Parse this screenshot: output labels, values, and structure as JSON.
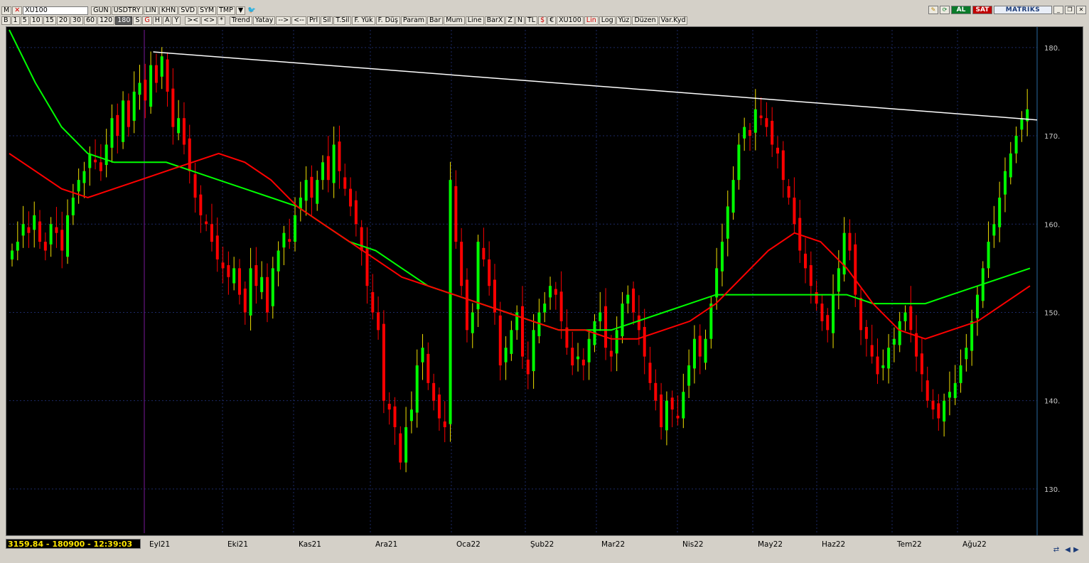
{
  "toolbar_top": {
    "menu_m": "M",
    "symbol": "XU100",
    "buttons": [
      "GUN",
      "USDTRY",
      "LIN",
      "KHN",
      "SVD",
      "SYM",
      "TMP"
    ],
    "al": "AL",
    "sat": "SAT",
    "brand": "MATRIKS"
  },
  "toolbar_periods": [
    "B",
    "1",
    "5",
    "10",
    "15",
    "20",
    "30",
    "60",
    "120",
    "180",
    "S",
    "G",
    "H",
    "A",
    "Y"
  ],
  "toolbar_nav": [
    "><",
    "<>",
    "*"
  ],
  "toolbar_tools": [
    "Trend",
    "Yatay",
    "-->",
    "<--",
    "Prl",
    "Sil",
    "T.Sil",
    "F. Yük",
    "F. Düş",
    "Param",
    "Bar",
    "Mum",
    "Line",
    "BarX",
    "Z",
    "N",
    "TL",
    "$",
    "€",
    "XU100",
    "Lin",
    "Log",
    "Yüz",
    "Düzen",
    "Var.Kyd"
  ],
  "status_text": "3159.84 - 180900 - 12:39:03",
  "colors": {
    "background": "#000000",
    "grid": "#1c2a66",
    "up": "#00ff00",
    "down": "#ff0000",
    "wick_up": "#f0e000",
    "ma_short": "#ff0000",
    "ma_long": "#00ff00",
    "trendline": "#ffffff"
  },
  "chart_data": {
    "type": "candlestick",
    "y_ticks": [
      "130.",
      "140.",
      "150.",
      "160.",
      "170.",
      "180."
    ],
    "ylim": [
      125,
      182
    ],
    "x_labels": [
      "Eyl21",
      "Eki21",
      "Kas21",
      "Ara21",
      "Oca22",
      "Şub22",
      "Mar22",
      "Nis22",
      "May22",
      "Haz22",
      "Tem22",
      "Ağu22"
    ],
    "candle_closes": [
      157,
      158,
      160,
      159,
      161,
      158,
      157,
      160,
      159,
      157,
      161,
      163,
      165,
      166,
      168,
      167,
      166,
      169,
      172,
      170,
      174,
      171,
      175,
      176,
      174,
      178,
      176,
      179,
      175,
      171,
      172,
      169,
      166,
      163,
      161,
      160,
      158,
      156,
      155,
      154,
      155,
      152,
      150,
      155,
      153,
      154,
      150,
      155,
      157,
      159,
      158,
      161,
      163,
      165,
      163,
      165,
      167,
      165,
      169,
      166,
      164,
      162,
      160,
      157,
      153,
      150,
      148,
      140,
      139,
      137,
      133,
      137,
      139,
      144,
      146,
      142,
      140,
      138,
      137,
      165,
      158,
      153,
      148,
      150,
      158,
      156,
      153,
      150,
      144,
      146,
      148,
      150,
      145,
      143,
      148,
      150,
      151,
      153,
      152,
      149,
      146,
      144,
      145,
      144,
      147,
      149,
      150,
      146,
      145,
      148,
      151,
      152,
      150,
      148,
      145,
      142,
      140,
      137,
      140,
      139,
      138,
      141,
      144,
      147,
      145,
      147,
      151,
      155,
      158,
      162,
      165,
      169,
      171,
      170,
      173,
      172,
      171,
      169,
      168,
      165,
      163,
      160,
      157,
      155,
      153,
      151,
      149,
      148,
      152,
      155,
      159,
      157,
      152,
      148,
      147,
      145,
      143,
      144,
      146,
      147,
      149,
      150,
      148,
      145,
      143,
      140,
      139,
      138,
      140,
      141,
      142,
      144,
      146,
      149,
      152,
      155,
      158,
      160,
      163,
      166,
      168,
      170,
      172,
      173
    ],
    "ma_short": [
      168,
      166,
      164,
      163,
      164,
      165,
      166,
      167,
      168,
      167,
      165,
      162,
      160,
      158,
      156,
      154,
      153,
      152,
      151,
      150,
      149,
      148,
      148,
      147,
      147,
      148,
      149,
      151,
      154,
      157,
      159,
      158,
      155,
      151,
      148,
      147,
      148,
      149,
      151,
      153
    ],
    "ma_long": [
      182,
      176,
      171,
      168,
      167,
      167,
      167,
      166,
      165,
      164,
      163,
      162,
      160,
      158,
      157,
      155,
      153,
      152,
      151,
      150,
      149,
      148,
      148,
      148,
      149,
      150,
      151,
      152,
      152,
      152,
      152,
      152,
      152,
      151,
      151,
      151,
      152,
      153,
      154,
      155
    ],
    "trendline": {
      "from": [
        0.14,
        179.5
      ],
      "to": [
        1.0,
        171.8
      ]
    }
  }
}
